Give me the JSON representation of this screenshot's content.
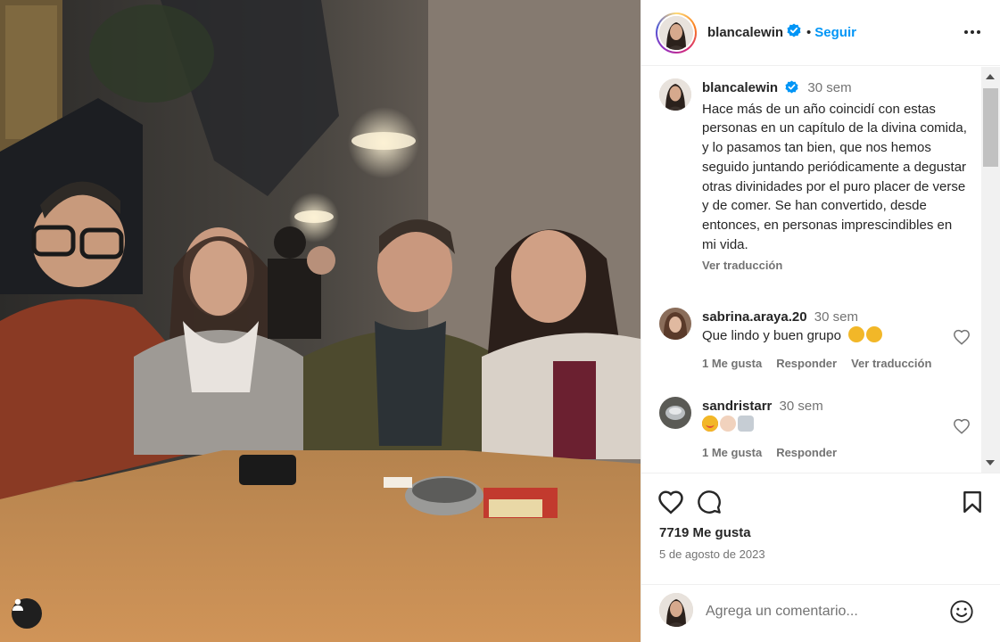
{
  "post": {
    "username": "blancalewin",
    "follow_label": "Seguir",
    "separator": "•",
    "caption_time": "30 sem",
    "caption": "Hace más de un año coincidí con estas personas en un capítulo de la divina comida, y lo pasamos tan bien, que nos hemos seguido juntando periódicamente a degustar otras divinidades por el puro placer de verse y de comer. Se han convertido, desde entonces, en personas imprescindibles en mi vida.",
    "see_translation": "Ver traducción",
    "likes_text": "7719 Me gusta",
    "date_text": "5 de agosto de 2023"
  },
  "comments": [
    {
      "username": "sabrina.araya.20",
      "time": "30 sem",
      "text": "Que lindo y buen grupo",
      "emojis": [
        "clapping-hands",
        "clapping-hands"
      ],
      "likes_label": "1 Me gusta",
      "reply_label": "Responder",
      "translate_label": "Ver traducción"
    },
    {
      "username": "sandristarr",
      "time": "30 sem",
      "text": "",
      "emojis": [
        "heart-eyes-face",
        "clapping-hands",
        "folded-hands"
      ],
      "likes_label": "1 Me gusta",
      "reply_label": "Responder"
    }
  ],
  "add_comment": {
    "placeholder": "Agrega un comentario..."
  },
  "icons": {
    "verified": "verified-badge-icon",
    "more": "more-options-icon",
    "like": "heart-icon",
    "comment": "comment-bubble-icon",
    "save": "bookmark-icon",
    "emoji": "emoji-smile-icon",
    "tag": "user-tag-icon"
  },
  "colors": {
    "accent": "#0095f6",
    "text": "#262626",
    "secondary": "#737373",
    "border": "#efefef"
  }
}
